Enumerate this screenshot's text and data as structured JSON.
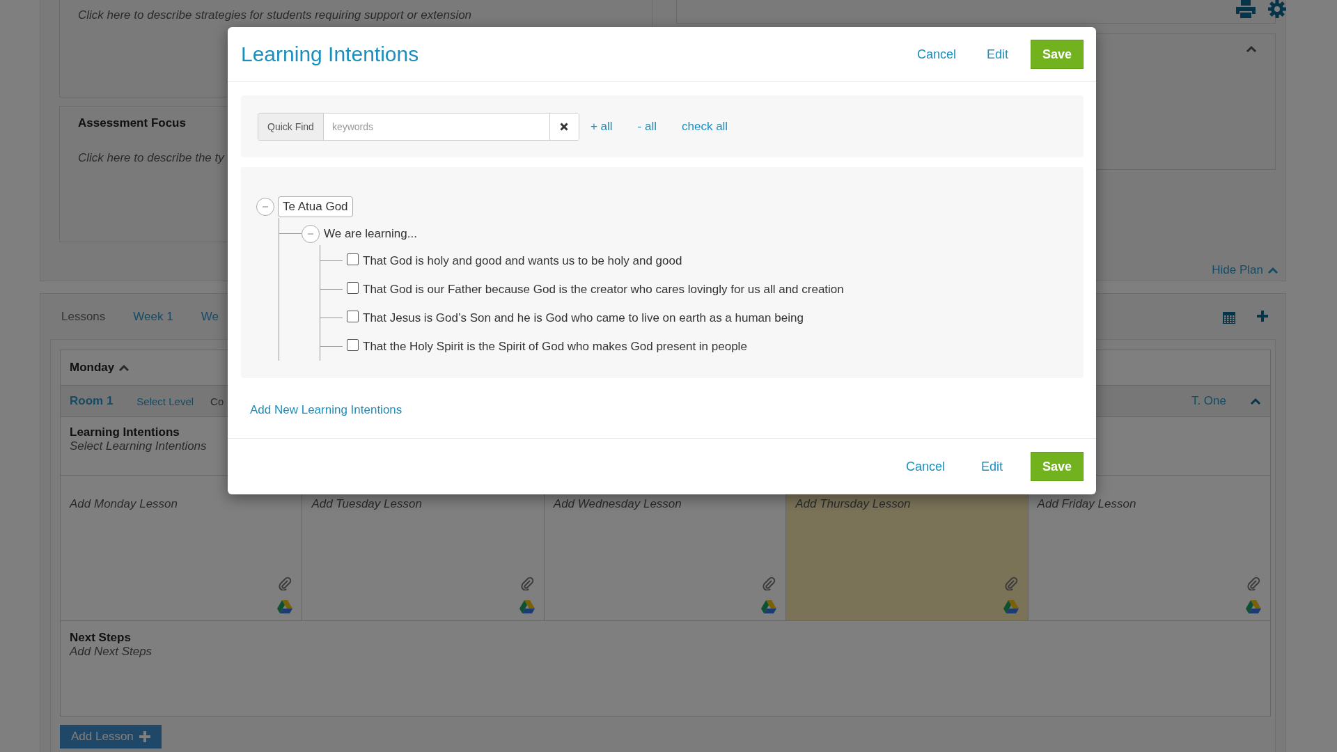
{
  "plan": {
    "strategies_placeholder": "Click here to describe strategies for students requiring support or extension",
    "assessment_title": "Assessment Focus",
    "assessment_placeholder": "Click here to describe the ty",
    "hide_plan": "Hide Plan"
  },
  "lessons": {
    "tabs": [
      {
        "label": "Lessons",
        "selected": true
      },
      {
        "label": "Week 1",
        "selected": false
      },
      {
        "label": "We",
        "selected": false
      }
    ],
    "day": "Monday",
    "room": "Room 1",
    "select_level": "Select Level",
    "column_3": "Co",
    "teacher": "T. One",
    "learning_intentions_title": "Learning Intentions",
    "learning_intentions_placeholder": "Select Learning Intentions",
    "days": [
      {
        "placeholder": "Add Monday Lesson",
        "highlighted": false
      },
      {
        "placeholder": "Add Tuesday Lesson",
        "highlighted": false
      },
      {
        "placeholder": "Add Wednesday Lesson",
        "highlighted": false
      },
      {
        "placeholder": "Add Thursday Lesson",
        "highlighted": true
      },
      {
        "placeholder": "Add Friday Lesson",
        "highlighted": false
      }
    ],
    "next_steps_title": "Next Steps",
    "next_steps_placeholder": "Add Next Steps",
    "add_lesson": "Add Lesson"
  },
  "modal": {
    "title": "Learning Intentions",
    "header_buttons": [
      {
        "label": "Cancel",
        "kind": "link"
      },
      {
        "label": "Edit",
        "kind": "link"
      },
      {
        "label": "Save",
        "kind": "primary"
      }
    ],
    "quick_find": {
      "label": "Quick Find",
      "placeholder": "keywords"
    },
    "actions": [
      "+ all",
      "- all",
      "check all"
    ],
    "tree": [
      {
        "label": "Te Atua God",
        "expanded": true,
        "children": [
          {
            "label": "We are learning...",
            "expanded": true,
            "children": [
              {
                "label": "That God is holy and good and wants us to be holy and good",
                "checked": false
              },
              {
                "label": "That God is our Father because God is the creator who cares lovingly for us all and creation",
                "checked": false
              },
              {
                "label": "That Jesus is God’s Son and he is God who came to live on earth as a human being",
                "checked": false
              },
              {
                "label": "That the Holy Spirit is the Spirit of God who makes God present in people",
                "checked": false
              }
            ]
          }
        ]
      }
    ],
    "add_link": "Add New Learning Intentions",
    "footer_buttons": [
      {
        "label": "Cancel",
        "kind": "link"
      },
      {
        "label": "Edit",
        "kind": "link"
      },
      {
        "label": "Save",
        "kind": "primary"
      }
    ]
  }
}
